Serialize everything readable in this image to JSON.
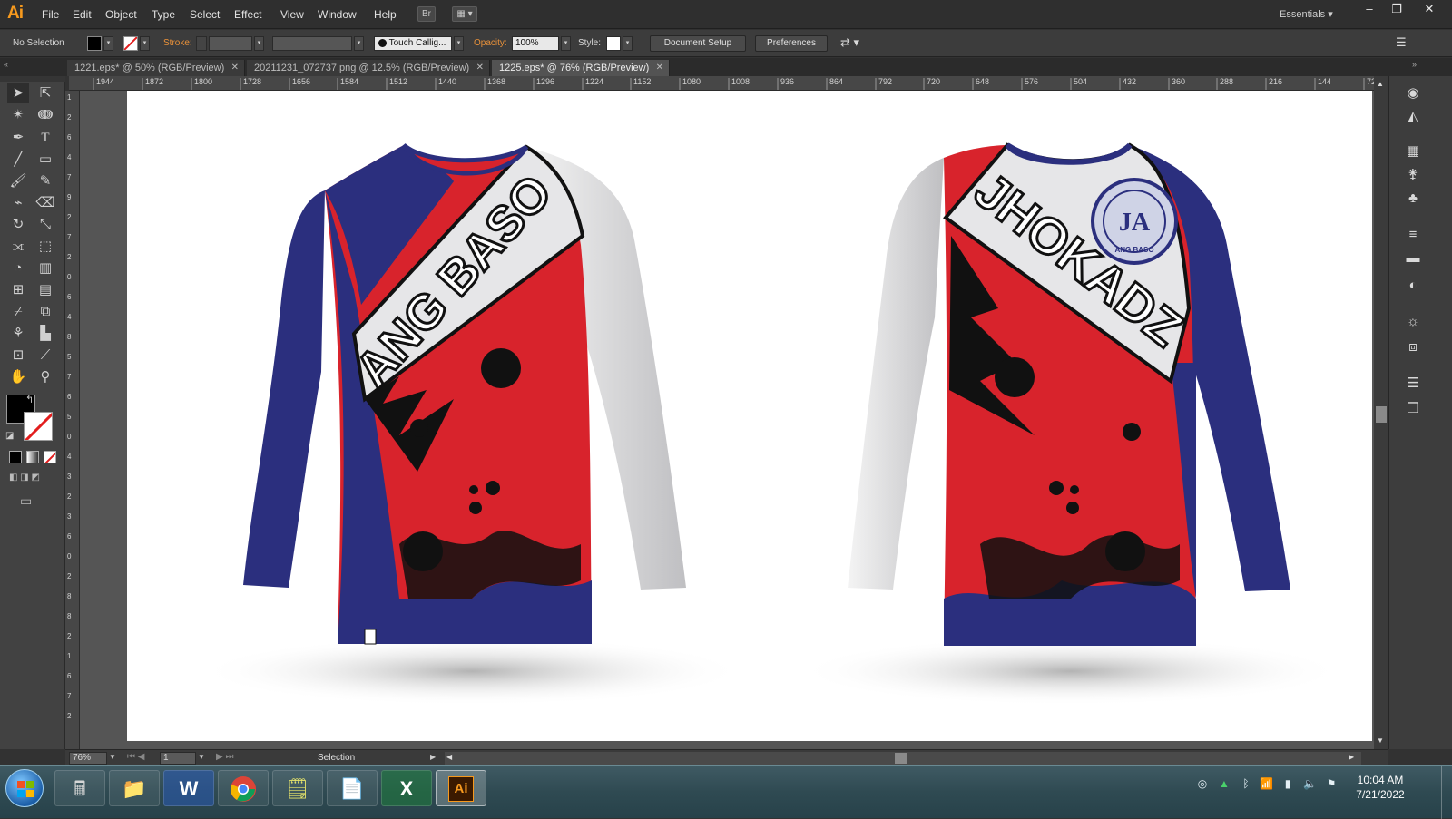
{
  "app": {
    "logo": "Ai",
    "menu": [
      "File",
      "Edit",
      "Object",
      "Type",
      "Select",
      "Effect",
      "View",
      "Window",
      "Help"
    ],
    "bridge_button": "Br",
    "workspace": "Essentials"
  },
  "control_bar": {
    "selection_status": "No Selection",
    "stroke_label": "Stroke:",
    "brush_name": "Touch Callig...",
    "opacity_label": "Opacity:",
    "opacity_value": "100%",
    "style_label": "Style:",
    "document_setup": "Document Setup",
    "preferences": "Preferences"
  },
  "tabs": [
    {
      "label": "1221.eps* @ 50% (RGB/Preview)",
      "active": false
    },
    {
      "label": "20211231_072737.png @ 12.5% (RGB/Preview)",
      "active": false
    },
    {
      "label": "1225.eps* @ 76% (RGB/Preview)",
      "active": true
    }
  ],
  "ruler": {
    "horizontal": [
      "1944",
      "1872",
      "1800",
      "1728",
      "1656",
      "1584",
      "1512",
      "1440",
      "1368",
      "1296",
      "1224",
      "1152",
      "1080",
      "1008",
      "936",
      "864",
      "792",
      "720",
      "648",
      "576",
      "504",
      "432",
      "360",
      "288",
      "216",
      "144",
      "72"
    ],
    "vertical": [
      "1",
      "2",
      "6",
      "4",
      "7",
      "9",
      "2",
      "7",
      "2",
      "0",
      "6",
      "4",
      "8",
      "5",
      "7",
      "6",
      "5",
      "0",
      "4",
      "3",
      "2",
      "3",
      "6",
      "0",
      "2",
      "8",
      "8",
      "2",
      "1",
      "6",
      "7",
      "2"
    ]
  },
  "artwork": {
    "front_text": "ANG BASO",
    "back_text": "JHOKADZ",
    "badge_text": "ANG BASO",
    "badge_letters": "JA",
    "colors": {
      "navy": "#2b2f7e",
      "red": "#d8232c",
      "white": "#e9e9ea",
      "black": "#111111"
    }
  },
  "status_bar": {
    "zoom": "76%",
    "page": "1",
    "tool_status": "Selection"
  },
  "taskbar": {
    "clock_time": "10:04 AM",
    "clock_date": "7/21/2022",
    "apps": [
      "start-orb",
      "calculator",
      "file-explorer",
      "word",
      "chrome",
      "sticky-notes",
      "notepad",
      "excel",
      "illustrator"
    ]
  }
}
